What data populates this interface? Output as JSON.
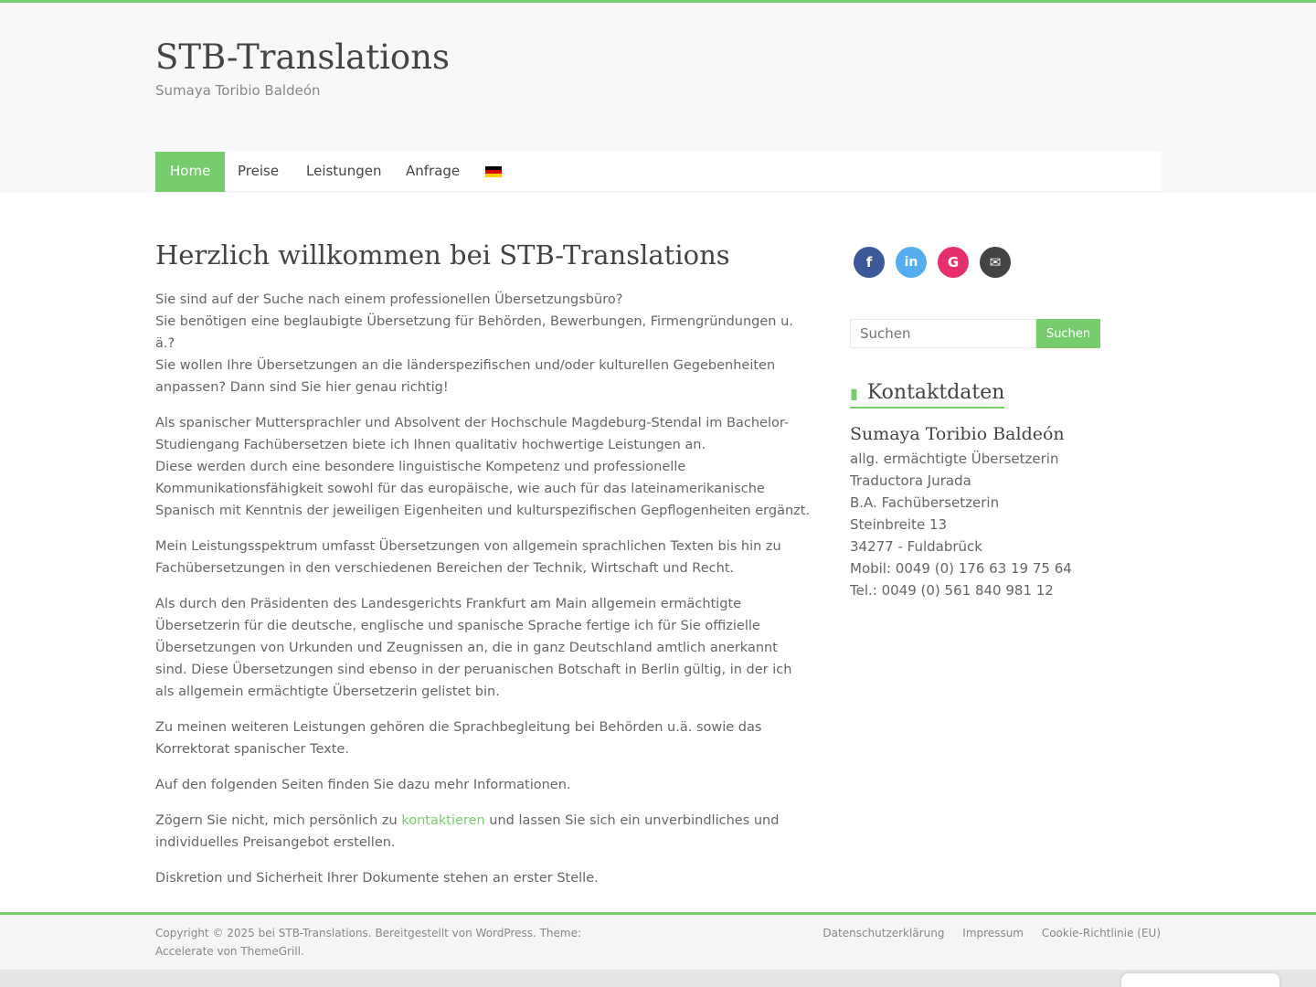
{
  "site": {
    "title": "STB-Translations",
    "tagline": "Sumaya Toribio Baldeón"
  },
  "nav": {
    "items": [
      {
        "label": "Home",
        "active": true
      },
      {
        "label": "Preise"
      },
      {
        "label": "Leistungen"
      },
      {
        "label": "Anfrage"
      }
    ],
    "language_flag": "de-flag-icon"
  },
  "main": {
    "heading": "Herzlich willkommen bei STB-Translations",
    "paragraphs": {
      "p1": "Sie sind auf der Suche nach einem professionellen Übersetzungsbüro?\nSie benötigen eine beglaubigte Übersetzung für Behörden, Bewerbungen, Firmengründungen u. ä.?\nSie wollen Ihre Übersetzungen an die länderspezifischen und/oder kulturellen Gegebenheiten anpassen? Dann sind Sie hier genau richtig!",
      "p2": "Als spanischer Muttersprachler und Absolvent der Hochschule Magdeburg-Stendal im Bachelor-Studiengang Fachübersetzen biete ich Ihnen qualitativ hochwertige Leistungen an.\nDiese werden durch eine besondere linguistische Kompetenz und professionelle Kommunikationsfähigkeit sowohl für das europäische, wie auch für das lateinamerikanische Spanisch mit Kenntnis der jeweiligen Eigenheiten und kulturspezifischen Gepflogenheiten ergänzt.",
      "p3": "Mein Leistungsspektrum umfasst Übersetzungen von allgemein sprachlichen Texten bis hin zu Fachübersetzungen in den verschiedenen Bereichen der Technik, Wirtschaft und Recht.",
      "p4": "Als durch den Präsidenten des Landesgerichts Frankfurt am Main allgemein ermächtigte Übersetzerin für die deutsche, englische und spanische Sprache fertige ich für Sie offizielle Übersetzungen von Urkunden und Zeugnissen an, die in ganz Deutschland amtlich anerkannt sind. Diese Übersetzungen sind ebenso in der peruanischen Botschaft in Berlin gültig, in der ich als allgemein ermächtigte Übersetzerin gelistet bin.",
      "p5": "Zu meinen weiteren Leistungen gehören die Sprachbegleitung bei Behörden u.ä. sowie das Korrektorat spanischer Texte.",
      "p6": "Auf den folgenden Seiten finden Sie dazu mehr Informationen.",
      "p7_before": "Zögern Sie nicht, mich persönlich zu ",
      "p7_link": "kontaktieren",
      "p7_after": " und lassen Sie sich ein unverbindliches und individuelles Preisangebot erstellen.",
      "p8": "Diskretion und Sicherheit Ihrer Dokumente stehen an erster Stelle."
    }
  },
  "sidebar": {
    "social": [
      {
        "icon": "facebook-icon",
        "glyph": "f",
        "color": "#3b5998"
      },
      {
        "icon": "linkedin-icon",
        "glyph": "in",
        "color": "#55acee"
      },
      {
        "icon": "google-icon",
        "glyph": "G",
        "color": "#e6306c"
      },
      {
        "icon": "email-icon",
        "glyph": "✉",
        "color": "#444444"
      }
    ],
    "search": {
      "placeholder": "Suchen",
      "button_label": "Suchen"
    },
    "contact": {
      "widget_title": "Kontaktdaten",
      "name": "Sumaya Toribio Baldeón",
      "lines": [
        "allg. ermächtigte Übersetzerin",
        "Traductora Jurada",
        "B.A. Fachübersetzerin",
        "Steinbreite 13",
        "34277 - Fuldabrück",
        "Mobil: 0049 (0) 176 63 19 75 64",
        "Tel.: 0049 (0) 561 840 981 12"
      ]
    }
  },
  "footer": {
    "copyright": "Copyright © 2025 bei STB-Translations. Bereitgestellt von WordPress. Theme: Accelerate von ThemeGrill.",
    "links": [
      "Datenschutzerklärung",
      "Impressum",
      "Cookie-Richtlinie (EU)"
    ]
  },
  "colors": {
    "accent": "#77cc6d",
    "flag_black": "#000000",
    "flag_red": "#dd0000",
    "flag_gold": "#ffce00"
  }
}
